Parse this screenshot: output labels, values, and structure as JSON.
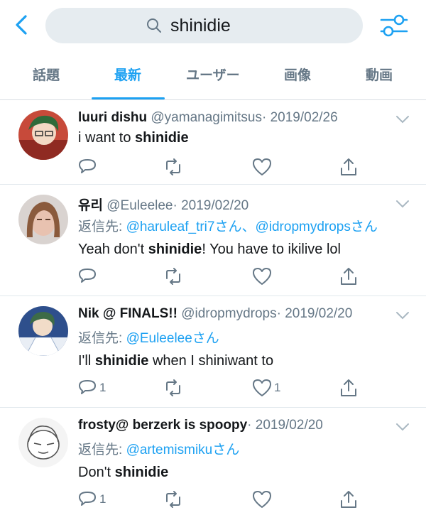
{
  "search": {
    "query": "shinidie"
  },
  "tabs": [
    {
      "label": "話題"
    },
    {
      "label": "最新"
    },
    {
      "label": "ユーザー"
    },
    {
      "label": "画像"
    },
    {
      "label": "動画"
    }
  ],
  "tweets": [
    {
      "name": "luuri dishu",
      "handle": "@yamanagimitsus",
      "date": "· 2019/02/26",
      "reply_prefix": "",
      "reply_to": "",
      "body_pre": "i want to ",
      "body_bold": "shinidie",
      "body_post": "",
      "reply_count": "",
      "like_count": ""
    },
    {
      "name": "유리",
      "handle": "@Euleelee",
      "date": "· 2019/02/20",
      "reply_prefix": "返信先: ",
      "reply_to": "@haruleaf_tri7さん、@idropmydropsさん",
      "body_pre": "Yeah don't ",
      "body_bold": "shinidie",
      "body_post": "! You have to ikilive lol",
      "reply_count": "",
      "like_count": ""
    },
    {
      "name": "Nik @ FINALS!!",
      "handle": "@idropmydrops",
      "date": "· 2019/02/20",
      "reply_prefix": "返信先: ",
      "reply_to": "@Euleeleeさん",
      "body_pre": "I'll ",
      "body_bold": "shinidie",
      "body_post": " when I shiniwant to",
      "reply_count": "1",
      "like_count": "1"
    },
    {
      "name": "frosty@ berzerk is spoopy",
      "handle": "",
      "date": "· 2019/02/20",
      "reply_prefix": "返信先: ",
      "reply_to": "@artemismikuさん",
      "body_pre": "Don't ",
      "body_bold": "shinidie",
      "body_post": "",
      "reply_count": "1",
      "like_count": ""
    }
  ],
  "colors": {
    "accent": "#1da1f2",
    "muted": "#657786",
    "text": "#14171a"
  },
  "icons": [
    "back-chevron-icon",
    "search-icon",
    "filter-sliders-icon",
    "caret-down-icon",
    "reply-icon",
    "retweet-icon",
    "like-heart-icon",
    "share-icon"
  ]
}
